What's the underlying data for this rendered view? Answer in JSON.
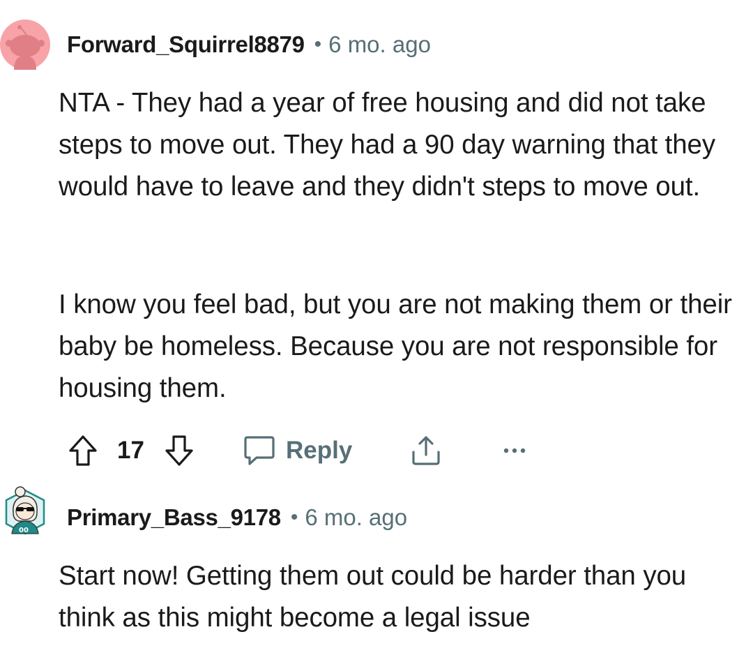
{
  "comments": [
    {
      "username": "Forward_Squirrel8879",
      "separator": "•",
      "timestamp": "6 mo. ago",
      "avatar_icon": "reddit-snoo-default-avatar-icon",
      "paragraphs": [
        "NTA - They had a year of free housing and did not take steps to move out. They had a 90 day warning that they would have to leave and they didn't steps to move out.",
        "I know you feel bad, but you are not making them or their baby be homeless. Because you are not responsible for housing them."
      ],
      "actions": {
        "upvote_icon": "upvote-arrow-icon",
        "vote_count": "17",
        "downvote_icon": "downvote-arrow-icon",
        "reply_icon": "comment-bubble-icon",
        "reply_label": "Reply",
        "share_icon": "share-icon",
        "more_icon": "ellipsis-icon"
      }
    },
    {
      "username": "Primary_Bass_9178",
      "separator": "•",
      "timestamp": "6 mo. ago",
      "avatar_icon": "reddit-custom-avatar-icon",
      "avatar_text": "00",
      "paragraphs": [
        "Start now! Getting them out could be harder than you think as this might become a legal issue"
      ]
    }
  ],
  "colors": {
    "text": "#1a1a1b",
    "meta": "#576f76",
    "avatar_pink": "#f7a3a8",
    "avatar_teal": "#1f8a8a"
  }
}
